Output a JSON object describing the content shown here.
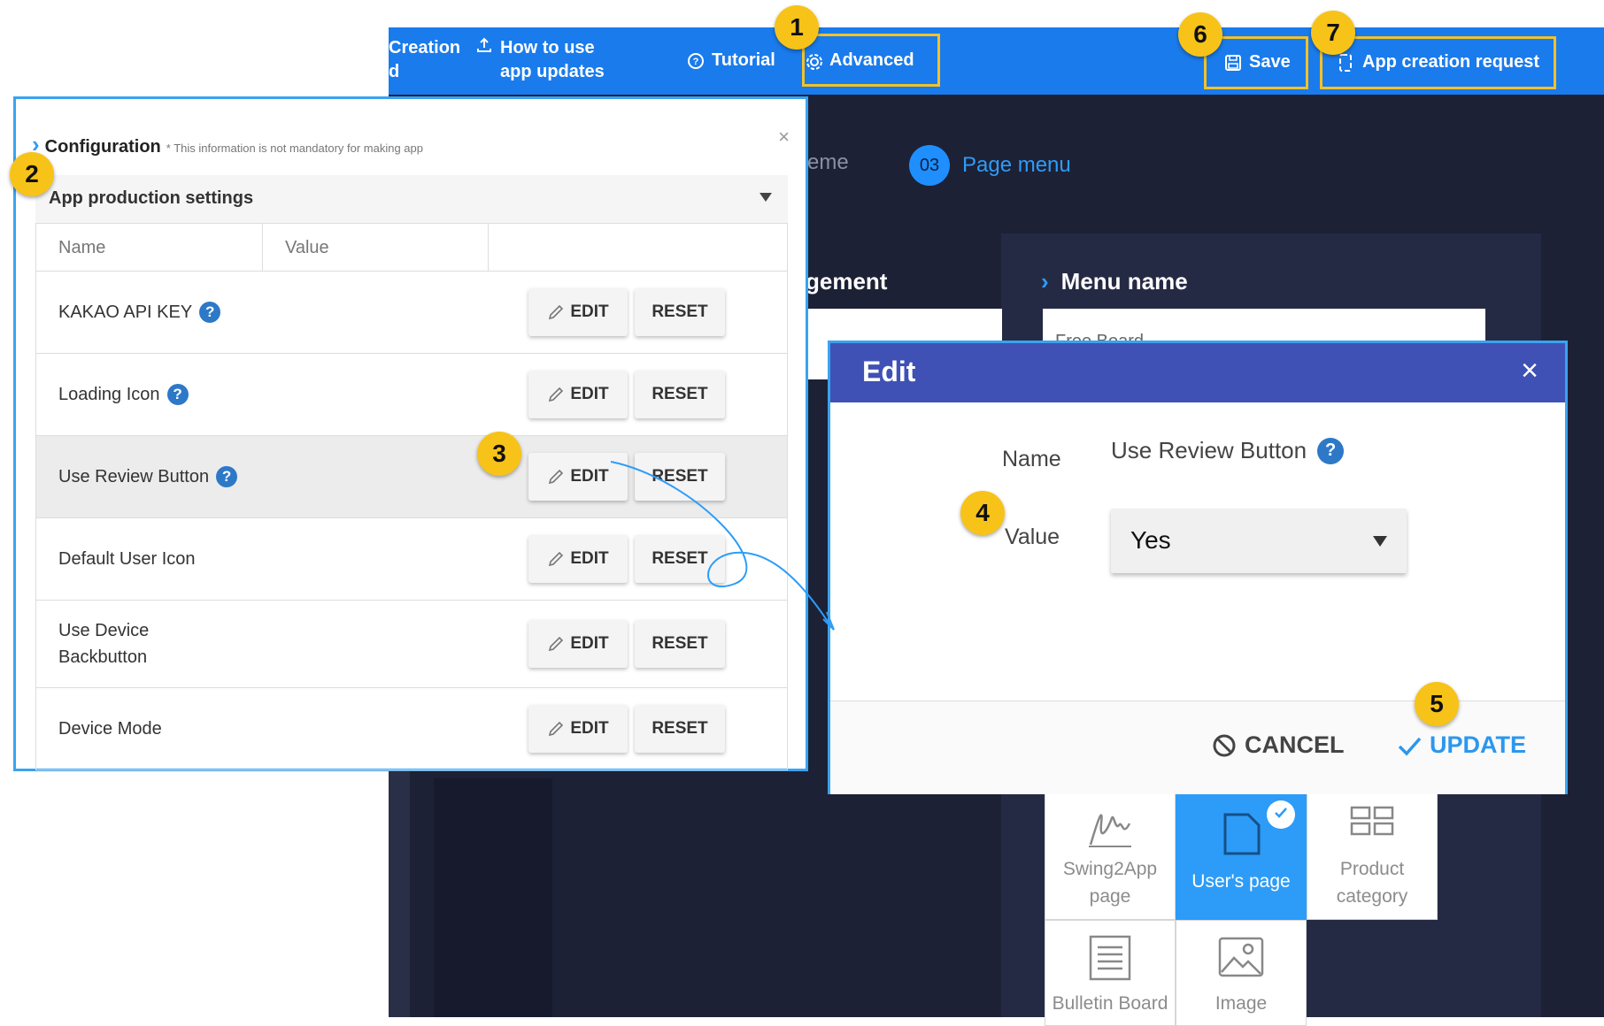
{
  "topbar": {
    "creation_label": "Creation",
    "creation_label2": "d",
    "how_to_label": "How to use app updates",
    "tutorial_label": "Tutorial",
    "advanced_label": "Advanced",
    "save_label": "Save",
    "app_request_label": "App creation request"
  },
  "steps": {
    "theme_label": "eme",
    "page_menu_num": "03",
    "page_menu_label": "Page menu"
  },
  "background": {
    "management_label": "gement",
    "menu_name_title": "Menu name",
    "menu_name_value": "Free Board",
    "tiles": [
      {
        "label": "Swing2App page",
        "icon": "signature-icon"
      },
      {
        "label": "User's page",
        "icon": "page-icon",
        "selected": true
      },
      {
        "label": "Product category",
        "icon": "grid-icon"
      },
      {
        "label": "Bulletin Board",
        "icon": "document-icon"
      },
      {
        "label": "Image",
        "icon": "image-icon"
      }
    ]
  },
  "config": {
    "title": "Configuration",
    "note": "* This information is not mandatory for making app",
    "close": "×",
    "section_label": "App production settings",
    "headers": {
      "name": "Name",
      "value": "Value"
    },
    "rows": [
      {
        "name": "KAKAO API KEY",
        "help": true
      },
      {
        "name": "Loading Icon",
        "help": true
      },
      {
        "name": "Use Review Button",
        "help": true,
        "highlighted": true
      },
      {
        "name": "Default User Icon",
        "help": false
      },
      {
        "name": "Use Device Backbutton",
        "help": false
      },
      {
        "name": "Device Mode",
        "help": false
      }
    ],
    "edit_label": "EDIT",
    "reset_label": "RESET"
  },
  "edit_dialog": {
    "title": "Edit",
    "close": "×",
    "name_label": "Name",
    "name_value": "Use Review Button",
    "value_label": "Value",
    "value_selected": "Yes",
    "cancel_label": "CANCEL",
    "update_label": "UPDATE"
  },
  "annotations": [
    "1",
    "2",
    "3",
    "4",
    "5",
    "6",
    "7"
  ],
  "colors": {
    "topbar": "#1a7bec",
    "dark_bg": "#1d2136",
    "dialog_header": "#3f51b5",
    "accent": "#3aa3f0",
    "badge": "#f8c318",
    "update": "#2b97ef"
  }
}
